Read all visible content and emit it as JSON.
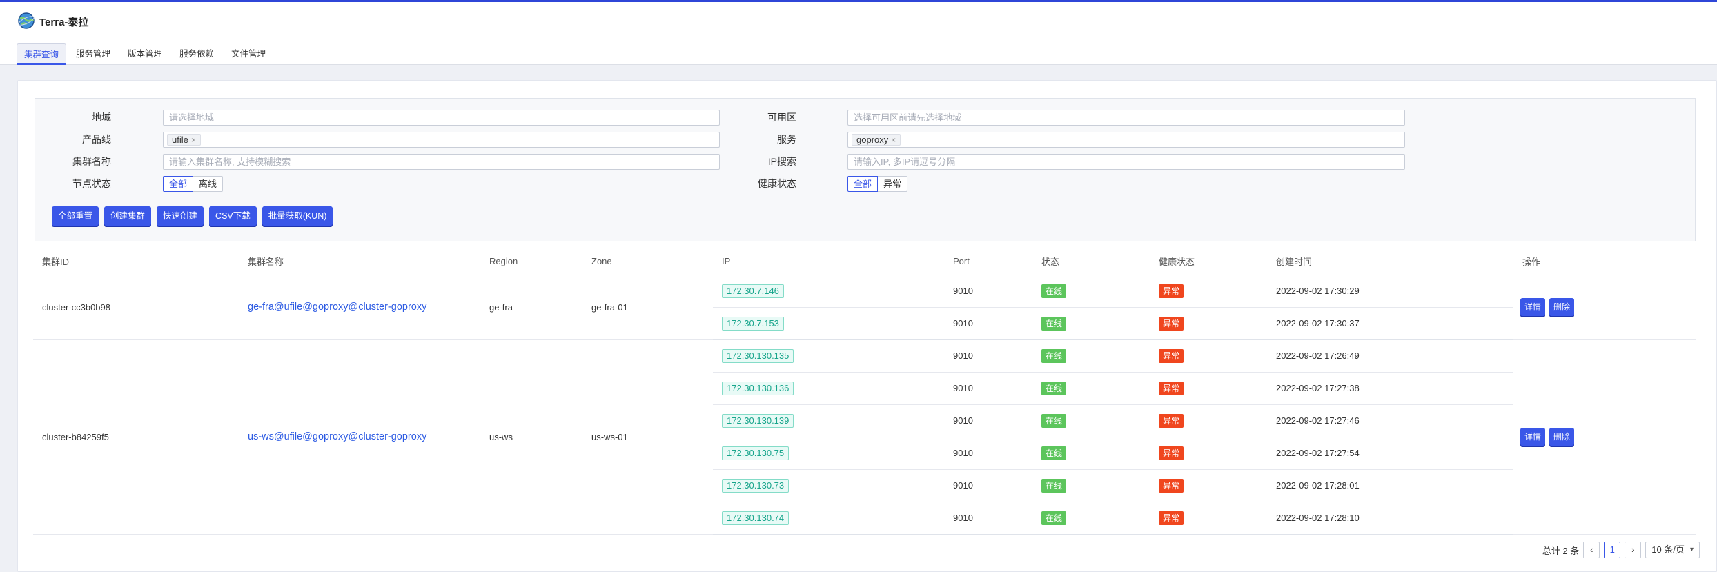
{
  "app": {
    "title": "Terra-泰拉",
    "logo_icon": "globe-icon"
  },
  "tabs": [
    {
      "label": "集群查询",
      "active": true
    },
    {
      "label": "服务管理",
      "active": false
    },
    {
      "label": "版本管理",
      "active": false
    },
    {
      "label": "服务依赖",
      "active": false
    },
    {
      "label": "文件管理",
      "active": false
    }
  ],
  "filters": {
    "region": {
      "label": "地域",
      "placeholder": "请选择地域"
    },
    "zone": {
      "label": "可用区",
      "placeholder": "选择可用区前请先选择地域"
    },
    "product": {
      "label": "产品线",
      "tag": "ufile"
    },
    "service": {
      "label": "服务",
      "tag": "goproxy"
    },
    "cluster_name": {
      "label": "集群名称",
      "placeholder": "请输入集群名称, 支持模糊搜索"
    },
    "ip_search": {
      "label": "IP搜索",
      "placeholder": "请输入IP, 多IP请逗号分隔"
    },
    "node_status": {
      "label": "节点状态",
      "options": [
        "全部",
        "离线"
      ],
      "selected": "全部"
    },
    "health_status": {
      "label": "健康状态",
      "options": [
        "全部",
        "异常"
      ],
      "selected": "全部"
    }
  },
  "actions": [
    "全部重置",
    "创建集群",
    "快速创建",
    "CSV下载",
    "批量获取(KUN)"
  ],
  "table": {
    "columns": [
      "集群ID",
      "集群名称",
      "Region",
      "Zone",
      "IP",
      "Port",
      "状态",
      "健康状态",
      "创建时间",
      "操作"
    ],
    "clusters": [
      {
        "id": "cluster-cc3b0b98",
        "name": "ge-fra@ufile@goproxy@cluster-goproxy",
        "region": "ge-fra",
        "zone": "ge-fra-01",
        "nodes": [
          {
            "ip": "172.30.7.146",
            "port": "9010",
            "status": "在线",
            "health": "异常",
            "created": "2022-09-02 17:30:29"
          },
          {
            "ip": "172.30.7.153",
            "port": "9010",
            "status": "在线",
            "health": "异常",
            "created": "2022-09-02 17:30:37"
          }
        ]
      },
      {
        "id": "cluster-b84259f5",
        "name": "us-ws@ufile@goproxy@cluster-goproxy",
        "region": "us-ws",
        "zone": "us-ws-01",
        "nodes": [
          {
            "ip": "172.30.130.135",
            "port": "9010",
            "status": "在线",
            "health": "异常",
            "created": "2022-09-02 17:26:49"
          },
          {
            "ip": "172.30.130.136",
            "port": "9010",
            "status": "在线",
            "health": "异常",
            "created": "2022-09-02 17:27:38"
          },
          {
            "ip": "172.30.130.139",
            "port": "9010",
            "status": "在线",
            "health": "异常",
            "created": "2022-09-02 17:27:46"
          },
          {
            "ip": "172.30.130.75",
            "port": "9010",
            "status": "在线",
            "health": "异常",
            "created": "2022-09-02 17:27:54"
          },
          {
            "ip": "172.30.130.73",
            "port": "9010",
            "status": "在线",
            "health": "异常",
            "created": "2022-09-02 17:28:01"
          },
          {
            "ip": "172.30.130.74",
            "port": "9010",
            "status": "在线",
            "health": "异常",
            "created": "2022-09-02 17:28:10"
          }
        ]
      }
    ],
    "row_actions": {
      "detail": "详情",
      "delete": "删除"
    }
  },
  "pagination": {
    "total": "总计 2 条",
    "current_page": "1",
    "page_size": "10 条/页"
  },
  "colors": {
    "accent": "#3a57e8",
    "online": "#5cc55c",
    "abnormal": "#f0461e",
    "ip_tag": "#17a58b"
  }
}
